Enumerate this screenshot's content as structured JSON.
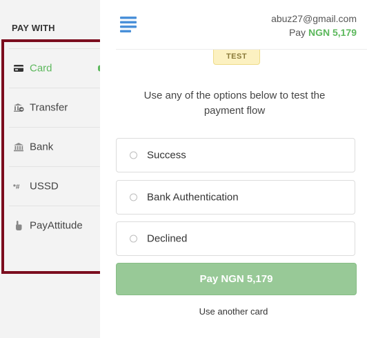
{
  "sidebar": {
    "heading": "PAY WITH",
    "items": [
      {
        "label": "Card",
        "icon": "card-icon",
        "active": true
      },
      {
        "label": "Transfer",
        "icon": "bank-transfer-icon",
        "active": false
      },
      {
        "label": "Bank",
        "icon": "bank-icon",
        "active": false
      },
      {
        "label": "USSD",
        "icon": "ussd-icon",
        "active": false
      },
      {
        "label": "PayAttitude",
        "icon": "hand-pointer-icon",
        "active": false
      }
    ]
  },
  "header": {
    "email": "abuz27@gmail.com",
    "pay_prefix": "Pay",
    "pay_amount": "NGN 5,179"
  },
  "badge": "TEST",
  "instructions": "Use any of the options below to test the payment flow",
  "options": [
    {
      "label": "Success"
    },
    {
      "label": "Bank Authentication"
    },
    {
      "label": "Declined"
    }
  ],
  "pay_button": "Pay NGN 5,179",
  "another_card": "Use another card",
  "colors": {
    "accent_green": "#5cb85c",
    "button_green": "#98c997",
    "highlight_border": "#7b0d1e",
    "sidebar_bg": "#f3f3f3",
    "logo_blue": "#4a90d9"
  }
}
